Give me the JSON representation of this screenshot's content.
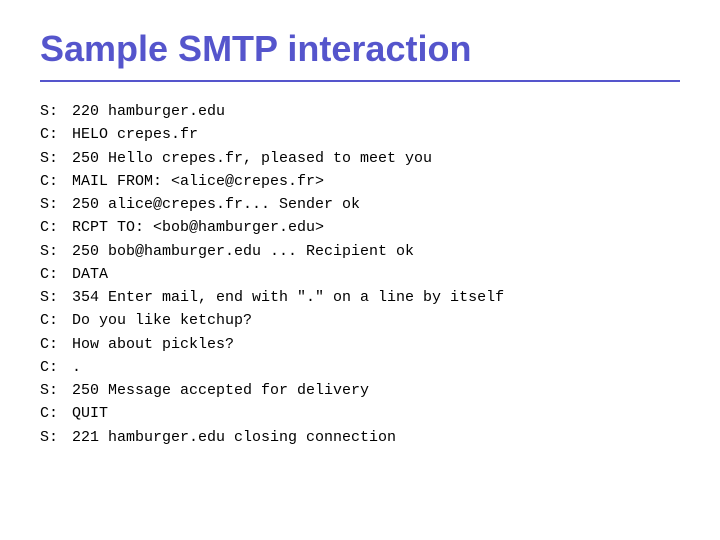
{
  "title": "Sample SMTP interaction",
  "divider_color": "#5555cc",
  "lines": [
    {
      "prefix": "S:",
      "text": "220 hamburger.edu"
    },
    {
      "prefix": "C:",
      "text": "HELO crepes.fr"
    },
    {
      "prefix": "S:",
      "text": "250  Hello crepes.fr, pleased to meet you"
    },
    {
      "prefix": "C:",
      "text": "MAIL FROM: <alice@crepes.fr>"
    },
    {
      "prefix": "S:",
      "text": "250 alice@crepes.fr... Sender ok"
    },
    {
      "prefix": "C:",
      "text": "RCPT TO: <bob@hamburger.edu>"
    },
    {
      "prefix": "S:",
      "text": "250 bob@hamburger.edu ... Recipient ok"
    },
    {
      "prefix": "C:",
      "text": "DATA"
    },
    {
      "prefix": "S:",
      "text": "354 Enter mail, end with \".\" on a line by itself"
    },
    {
      "prefix": "C:",
      "text": "Do you like ketchup?"
    },
    {
      "prefix": "C:",
      "text": "  How about pickles?"
    },
    {
      "prefix": "C:",
      "text": "."
    },
    {
      "prefix": "S:",
      "text": "250 Message accepted for delivery"
    },
    {
      "prefix": "C:",
      "text": "QUIT"
    },
    {
      "prefix": "S:",
      "text": "221 hamburger.edu closing connection"
    }
  ]
}
